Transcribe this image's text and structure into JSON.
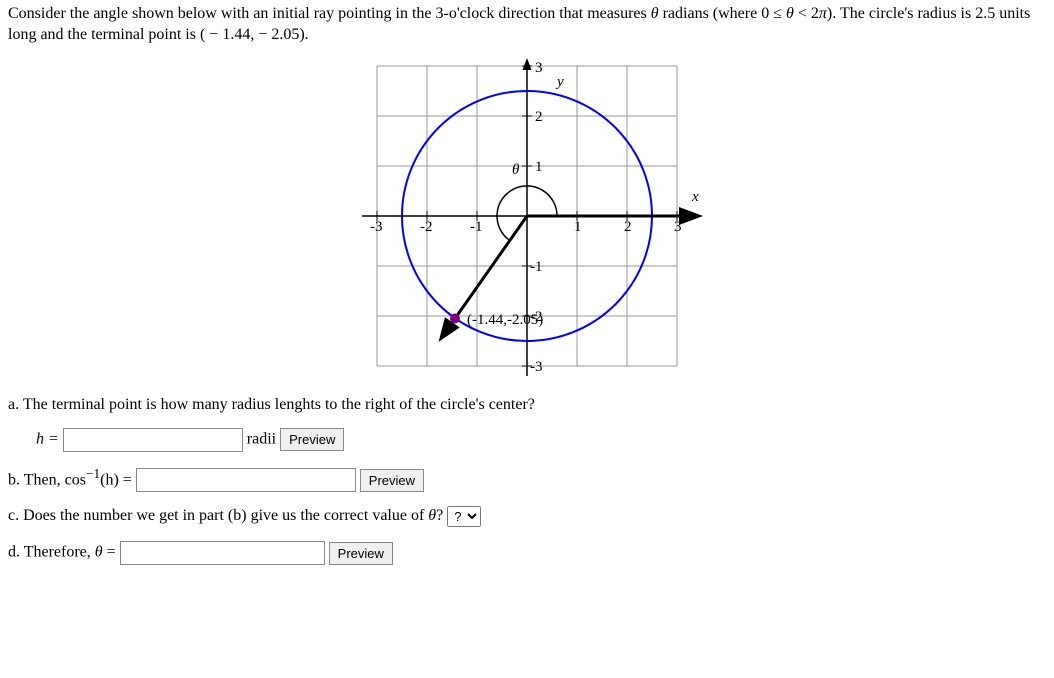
{
  "problem_text_1": "Consider the angle shown below with an initial ray pointing in the 3-o'clock direction that measures ",
  "theta": "θ",
  "problem_text_2": " radians (where 0 ≤ ",
  "problem_text_3": " < 2",
  "pi": "π",
  "problem_text_4": "). The circle's radius is 2.5 units long and the terminal point is ( − 1.44,  − 2.05).",
  "part_a_text": "a. The terminal point is how many radius lenghts to the right of the circle's center?",
  "h_label": "h =",
  "radii_label": "radii",
  "preview_label": "Preview",
  "part_b_text_1": "b. Then, cos",
  "part_b_text_2": "(h) = ",
  "superscript_neg1": "−1",
  "part_c_text": "c. Does the number we get in part (b) give us the correct value of ",
  "part_c_text_2": "?",
  "select_placeholder": "?",
  "part_d_text_1": "d. Therefore, ",
  "part_d_text_2": " = ",
  "chart_data": {
    "type": "diagram",
    "x_range": [
      -3,
      3
    ],
    "y_range": [
      -3,
      3
    ],
    "circle_radius": 2.5,
    "terminal_point": [
      -1.44,
      -2.05
    ],
    "terminal_point_label": "(-1.44,-2.05)",
    "x_ticks": [
      -3,
      -2,
      -1,
      1,
      2,
      3
    ],
    "y_ticks": [
      -3,
      -2,
      -1,
      1,
      2,
      3
    ],
    "x_axis_label": "x",
    "y_axis_label": "y",
    "theta_label": "θ",
    "initial_ray_end": [
      3.2,
      0
    ],
    "terminal_ray_end": [
      -1.7,
      -2.42
    ],
    "shows_angle_arc": true
  }
}
